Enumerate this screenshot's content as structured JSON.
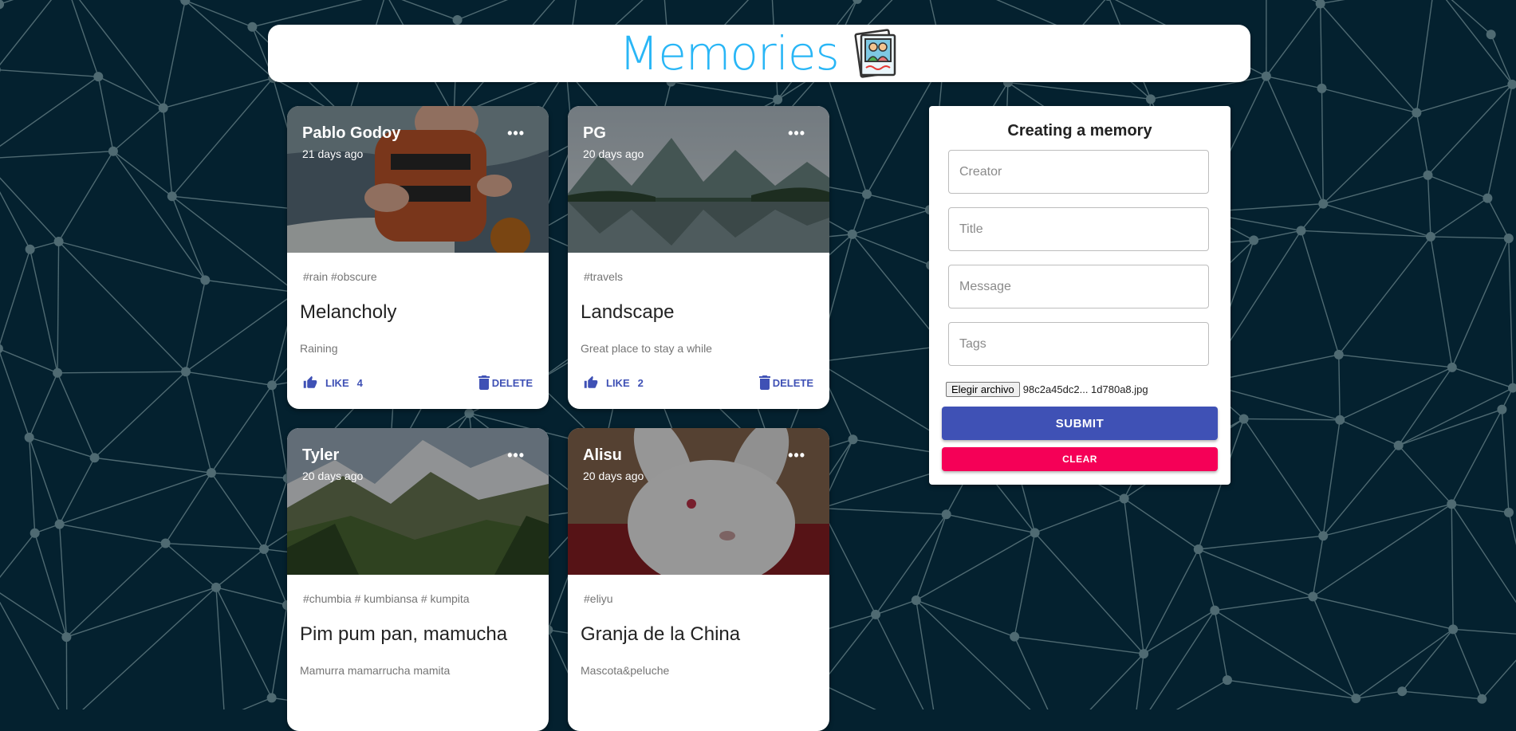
{
  "app": {
    "title": "Memories",
    "logo_icon": "photo-album-icon",
    "colors": {
      "background": "#04212f",
      "title": "#29b6f6",
      "primary": "#3f51b5",
      "secondary": "#f50057"
    }
  },
  "posts": [
    {
      "author": "Pablo Godoy",
      "time": "21 days ago",
      "tags": "#rain #obscure",
      "title": "Melancholy",
      "message": "Raining",
      "like_label": "LIKE",
      "like_count": "4",
      "delete_label": "DELETE",
      "image": "baby-in-boat"
    },
    {
      "author": "PG",
      "time": "20 days ago",
      "tags": "#travels",
      "title": "Landscape",
      "message": "Great place to stay a while",
      "like_label": "LIKE",
      "like_count": "2",
      "delete_label": "DELETE",
      "image": "mountain-lake"
    },
    {
      "author": "Tyler",
      "time": "20 days ago",
      "tags": "#chumbia # kumbiansa # kumpita",
      "title": "Pim pum pan, mamucha",
      "message": "Mamurra mamarrucha mamita",
      "image": "alpine-valley"
    },
    {
      "author": "Alisu",
      "time": "20 days ago",
      "tags": "#eliyu",
      "title": "Granja de la China",
      "message": "Mascota&peluche",
      "image": "white-rabbit"
    }
  ],
  "form": {
    "title": "Creating a memory",
    "creator_placeholder": "Creator",
    "title_placeholder": "Title",
    "message_placeholder": "Message",
    "tags_placeholder": "Tags",
    "file_button": "Elegir archivo",
    "file_name": "98c2a45dc2... 1d780a8.jpg",
    "submit_label": "SUBMIT",
    "clear_label": "CLEAR"
  }
}
